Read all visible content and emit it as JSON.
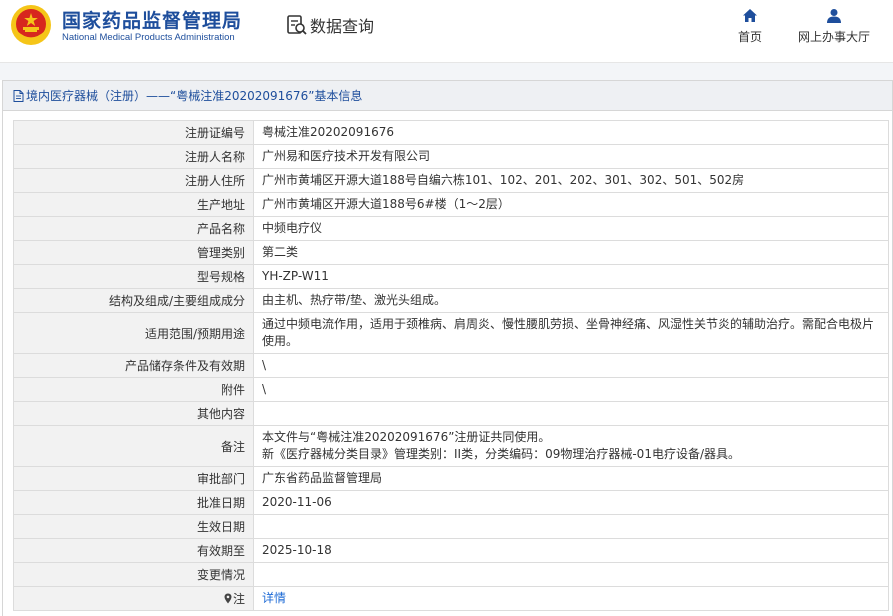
{
  "header": {
    "agency_cn": "国家药品监督管理局",
    "agency_en": "National Medical Products Administration",
    "query_label": "数据查询",
    "nav": [
      {
        "label": "首页",
        "icon": "home-icon"
      },
      {
        "label": "网上办事大厅",
        "icon": "user-icon"
      }
    ]
  },
  "colors": {
    "brand_blue": "#1e4e9c",
    "link_blue": "#1e6bd6",
    "emblem_red": "#d7261e",
    "emblem_gold": "#f5c518"
  },
  "panel": {
    "title": "境内医疗器械（注册）——“粤械注准20202091676”基本信息"
  },
  "rows": [
    {
      "label": "注册证编号",
      "value": "粤械注准20202091676"
    },
    {
      "label": "注册人名称",
      "value": "广州易和医疗技术开发有限公司"
    },
    {
      "label": "注册人住所",
      "value": "广州市黄埔区开源大道188号自编六栋101、102、201、202、301、302、501、502房"
    },
    {
      "label": "生产地址",
      "value": "广州市黄埔区开源大道188号6#楼（1～2层）"
    },
    {
      "label": "产品名称",
      "value": "中频电疗仪"
    },
    {
      "label": "管理类别",
      "value": "第二类"
    },
    {
      "label": "型号规格",
      "value": "YH-ZP-W11"
    },
    {
      "label": "结构及组成/主要组成成分",
      "value": "由主机、热疗带/垫、激光头组成。"
    },
    {
      "label": "适用范围/预期用途",
      "value": "通过中频电流作用，适用于颈椎病、肩周炎、慢性腰肌劳损、坐骨神经痛、风湿性关节炎的辅助治疗。需配合电极片使用。"
    },
    {
      "label": "产品储存条件及有效期",
      "value": "\\"
    },
    {
      "label": "附件",
      "value": "\\"
    },
    {
      "label": "其他内容",
      "value": ""
    },
    {
      "label": "备注",
      "value": "本文件与“粤械注准20202091676”注册证共同使用。",
      "value2": "新《医疗器械分类目录》管理类别：II类，分类编码：09物理治疗器械-01电疗设备/器具。"
    },
    {
      "label": "审批部门",
      "value": "广东省药品监督管理局"
    },
    {
      "label": "批准日期",
      "value": "2020-11-06"
    },
    {
      "label": "生效日期",
      "value": ""
    },
    {
      "label": "有效期至",
      "value": "2025-10-18"
    },
    {
      "label": "变更情况",
      "value": ""
    },
    {
      "label": "注",
      "value": "详情",
      "icon": "location-pin-icon"
    }
  ]
}
